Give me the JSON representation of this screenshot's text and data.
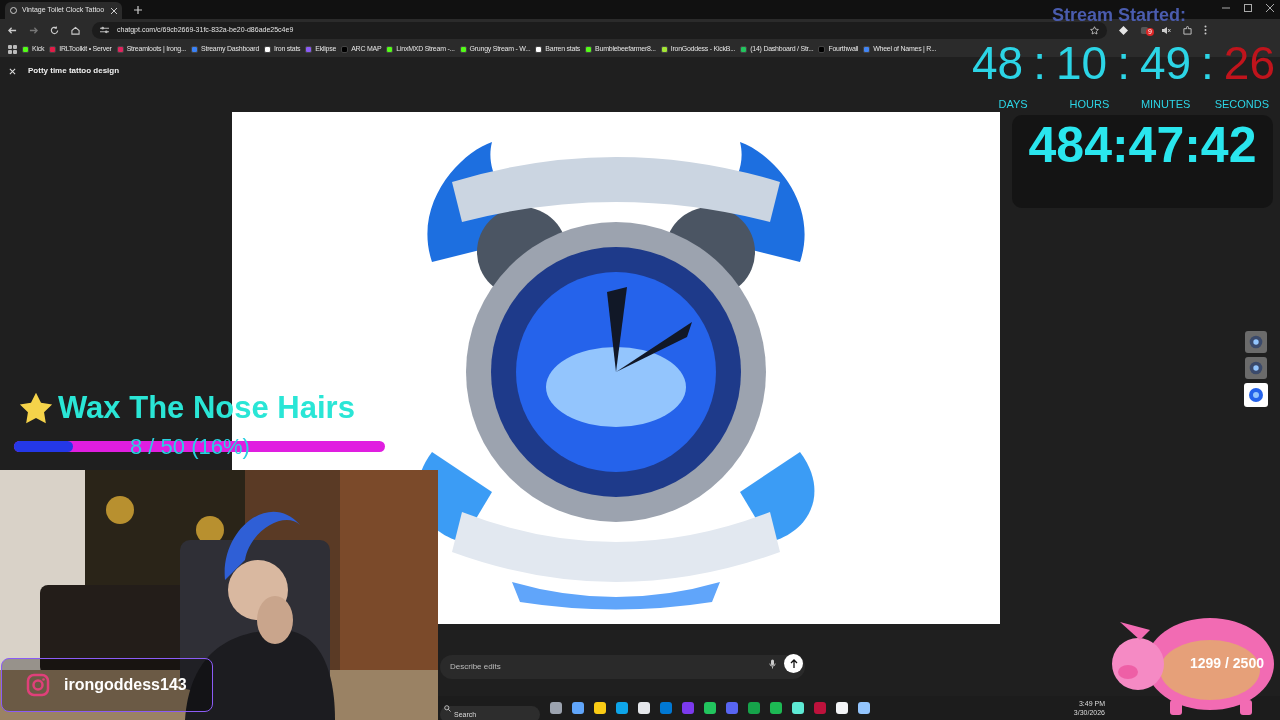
{
  "browser": {
    "tabs": [
      {
        "title": "Vintage Toilet Clock Tattoo",
        "selected": true
      }
    ],
    "address": "chatgpt.com/c/69cb2669-31fc-832a-be20-d86ade25c4e9",
    "extension_badge": "9",
    "bookmarks": [
      {
        "label": "Kick",
        "color": "#53fc18"
      },
      {
        "label": "IRLToolkit • Server",
        "color": "#e11d48"
      },
      {
        "label": "Streamloots | Irong...",
        "color": "#e0245e"
      },
      {
        "label": "Streamy Dashboard",
        "color": "#3b82f6"
      },
      {
        "label": "Iron stats",
        "color": "#ffffff"
      },
      {
        "label": "Eklipse",
        "color": "#8b5cf6"
      },
      {
        "label": "ARC MAP",
        "color": "#000000"
      },
      {
        "label": "LinxMXD Stream -...",
        "color": "#53fc18"
      },
      {
        "label": "Grungy Stream - W...",
        "color": "#53fc18"
      },
      {
        "label": "Barren stats",
        "color": "#ffffff"
      },
      {
        "label": "Bumblebeefarmer8...",
        "color": "#53fc18"
      },
      {
        "label": "IronGoddess - KickB...",
        "color": "#a3e635"
      },
      {
        "label": "(14) Dashboard / Str...",
        "color": "#22c55e"
      },
      {
        "label": "Fourthwall",
        "color": "#000000"
      },
      {
        "label": "Wheel of Names | R...",
        "color": "#4285f4"
      }
    ]
  },
  "page": {
    "title": "Potty time tattoo design",
    "thumbnails": [
      {
        "selected": false
      },
      {
        "selected": false
      },
      {
        "selected": true
      }
    ],
    "prompt": {
      "placeholder": "Describe edits"
    }
  },
  "overlay": {
    "stream_started": "Stream Started:",
    "countdown": [
      {
        "text": "48",
        "color": "#2cd5e6"
      },
      {
        "text": ":",
        "color": "#2cd5e6"
      },
      {
        "text": "10",
        "color": "#2cd5e6"
      },
      {
        "text": ":",
        "color": "#2cd5e6"
      },
      {
        "text": "49",
        "color": "#2cd5e6"
      },
      {
        "text": ":",
        "color": "#2cd5e6"
      },
      {
        "text": "26",
        "color": "#c0141c"
      }
    ],
    "units": [
      "DAYS",
      "HOURS",
      "MINUTES",
      "SECONDS"
    ],
    "uptime": "484:47:42",
    "goal": {
      "title": "Wax The Nose Hairs",
      "progress": "8 / 50 (16%)",
      "level": 0.16
    },
    "social": {
      "handle": "irongoddess143"
    },
    "counter": "1299 / 2500"
  },
  "taskbar": {
    "search_placeholder": "Search",
    "apps": [
      {
        "color": "#9ca3af"
      },
      {
        "color": "#60a5fa"
      },
      {
        "color": "#facc15"
      },
      {
        "color": "#0ea5e9"
      },
      {
        "color": "#e5e7eb"
      },
      {
        "color": "#0078d4"
      },
      {
        "color": "#7c3aed"
      },
      {
        "color": "#22c55e"
      },
      {
        "color": "#5865f2"
      },
      {
        "color": "#16a34a"
      },
      {
        "color": "#1db954"
      },
      {
        "color": "#5eead4"
      },
      {
        "color": "#be123c"
      },
      {
        "color": "#f3f4f6"
      },
      {
        "color": "#93c5fd"
      }
    ],
    "time": "3:49 PM",
    "date": "3/30/2026"
  }
}
